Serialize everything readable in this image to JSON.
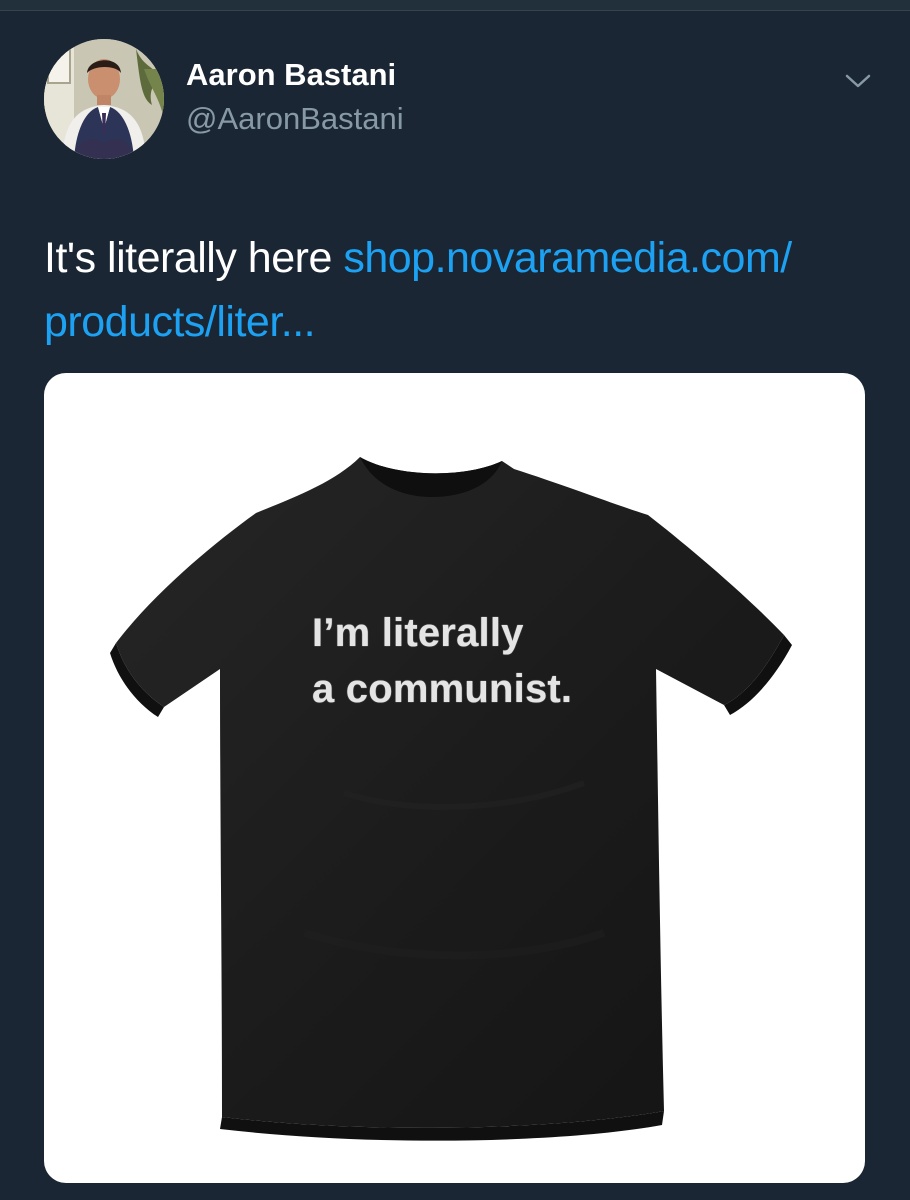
{
  "tweet": {
    "author": {
      "display_name": "Aaron Bastani",
      "handle": "@AaronBastani",
      "avatar_icon": "profile-photo"
    },
    "menu_icon": "chevron-down-icon",
    "text": {
      "body": "It's literally here ",
      "link_text": "shop.novaramedia.com/ products/liter..."
    },
    "media": {
      "shirt_print": "I’m literally\na communist.",
      "shirt_color": "#1b1b1b"
    }
  },
  "colors": {
    "background": "#1a2633",
    "link": "#1da1f2",
    "secondary_text": "#8899a6"
  }
}
